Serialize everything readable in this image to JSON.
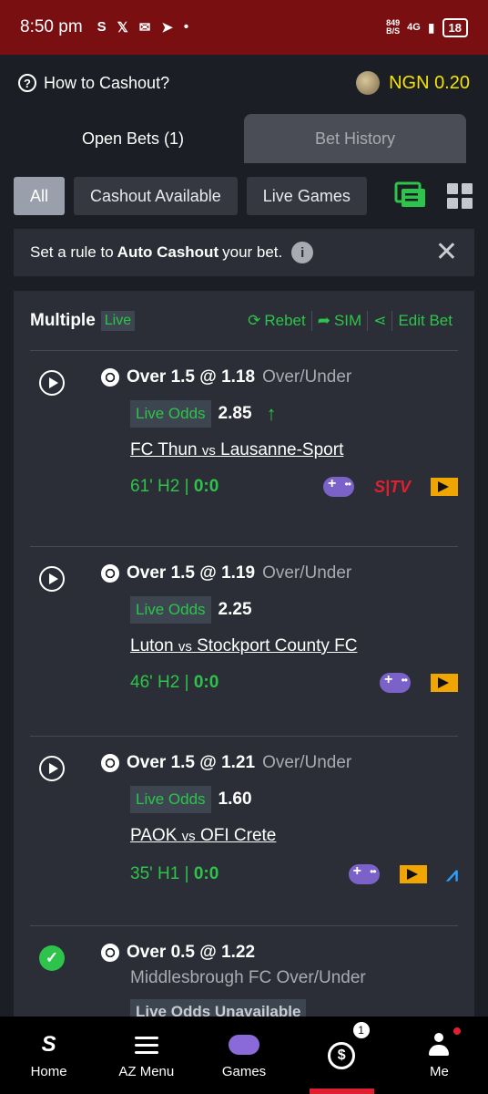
{
  "status_bar": {
    "time": "8:50 pm",
    "speed_top": "849",
    "speed_bottom": "B/S",
    "network": "4G",
    "battery": "18"
  },
  "top": {
    "help_text": "How to Cashout?",
    "balance": "NGN 0.20"
  },
  "tabs": [
    {
      "label": "Open Bets (1)"
    },
    {
      "label": "Bet History"
    }
  ],
  "filters": [
    {
      "label": "All"
    },
    {
      "label": "Cashout Available"
    },
    {
      "label": "Live Games"
    }
  ],
  "rule_bar": {
    "prefix": "Set a rule to ",
    "bold": "Auto Cashout",
    "suffix": " your bet."
  },
  "card": {
    "title": "Multiple",
    "live": "Live",
    "actions": {
      "rebet": "Rebet",
      "sim": "SIM",
      "edit": "Edit Bet"
    },
    "selections": [
      {
        "pick": "Over 1.5 @ 1.18",
        "market": "Over/Under",
        "odds_label": "Live Odds",
        "odds": "2.85",
        "home": "FC Thun",
        "vs": "vs",
        "away": "Lausanne-Sport",
        "clock": "61' H2 | ",
        "score": "0:0"
      },
      {
        "pick": "Over 1.5 @ 1.19",
        "market": "Over/Under",
        "odds_label": "Live Odds",
        "odds": "2.25",
        "home": "Luton",
        "vs": "vs",
        "away": "Stockport County FC",
        "clock": "46' H2 | ",
        "score": "0:0"
      },
      {
        "pick": "Over 1.5 @ 1.21",
        "market": "Over/Under",
        "odds_label": "Live Odds",
        "odds": "1.60",
        "home": "PAOK",
        "vs": "vs",
        "away": "OFI Crete",
        "clock": "35' H1 | ",
        "score": "0:0"
      },
      {
        "pick": "Over 0.5 @ 1.22",
        "market": "Middlesbrough FC Over/Under",
        "unavailable": "Live Odds Unavailable"
      }
    ]
  },
  "nav": [
    {
      "label": "Home"
    },
    {
      "label": "AZ Menu"
    },
    {
      "label": "Games"
    },
    {
      "label": "",
      "badge": "1"
    },
    {
      "label": "Me"
    }
  ]
}
